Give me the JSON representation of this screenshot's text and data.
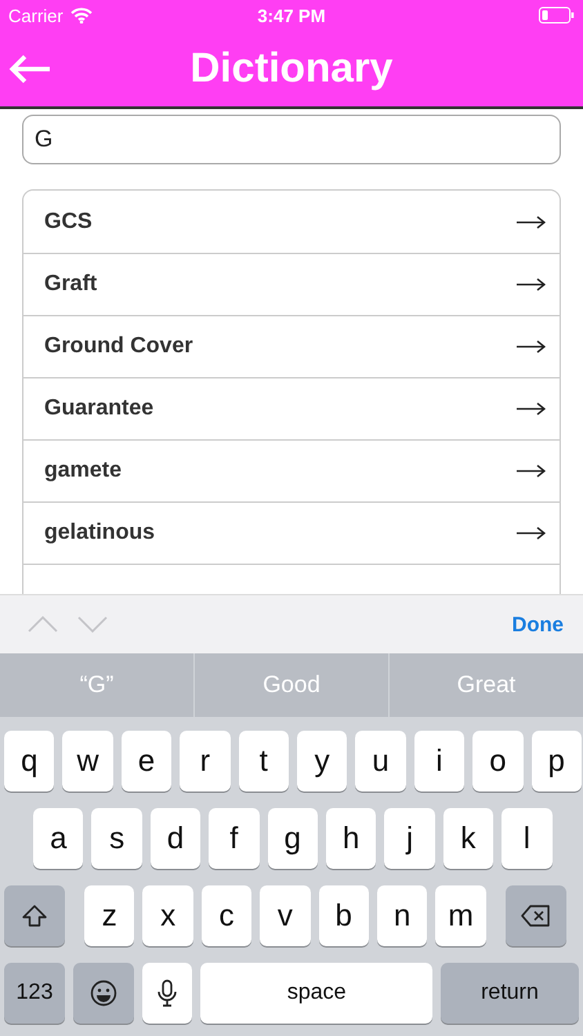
{
  "status_bar": {
    "carrier": "Carrier",
    "time": "3:47 PM"
  },
  "nav_bar": {
    "title": "Dictionary"
  },
  "search": {
    "value": "G"
  },
  "results": [
    {
      "word": "GCS"
    },
    {
      "word": "Graft"
    },
    {
      "word": "Ground Cover"
    },
    {
      "word": "Guarantee"
    },
    {
      "word": "gamete"
    },
    {
      "word": "gelatinous"
    }
  ],
  "keyboard_toolbar": {
    "done": "Done"
  },
  "suggestions": [
    {
      "text": "“G”"
    },
    {
      "text": "Good"
    },
    {
      "text": "Great"
    }
  ],
  "keyboard_rows": [
    [
      {
        "kind": "letter",
        "label": "q"
      },
      {
        "kind": "letter",
        "label": "w"
      },
      {
        "kind": "letter",
        "label": "e"
      },
      {
        "kind": "letter",
        "label": "r"
      },
      {
        "kind": "letter",
        "label": "t"
      },
      {
        "kind": "letter",
        "label": "y"
      },
      {
        "kind": "letter",
        "label": "u"
      },
      {
        "kind": "letter",
        "label": "i"
      },
      {
        "kind": "letter",
        "label": "o"
      },
      {
        "kind": "letter",
        "label": "p"
      }
    ],
    [
      {
        "kind": "letter",
        "label": "a"
      },
      {
        "kind": "letter",
        "label": "s"
      },
      {
        "kind": "letter",
        "label": "d"
      },
      {
        "kind": "letter",
        "label": "f"
      },
      {
        "kind": "letter",
        "label": "g"
      },
      {
        "kind": "letter",
        "label": "h"
      },
      {
        "kind": "letter",
        "label": "j"
      },
      {
        "kind": "letter",
        "label": "k"
      },
      {
        "kind": "letter",
        "label": "l"
      }
    ],
    [
      {
        "kind": "shift"
      },
      {
        "kind": "letter",
        "label": "z"
      },
      {
        "kind": "letter",
        "label": "x"
      },
      {
        "kind": "letter",
        "label": "c"
      },
      {
        "kind": "letter",
        "label": "v"
      },
      {
        "kind": "letter",
        "label": "b"
      },
      {
        "kind": "letter",
        "label": "n"
      },
      {
        "kind": "letter",
        "label": "m"
      },
      {
        "kind": "delete"
      }
    ],
    [
      {
        "kind": "numbers",
        "label": "123"
      },
      {
        "kind": "emoji"
      },
      {
        "kind": "mic"
      },
      {
        "kind": "space",
        "label": "space"
      },
      {
        "kind": "return",
        "label": "return"
      }
    ]
  ]
}
